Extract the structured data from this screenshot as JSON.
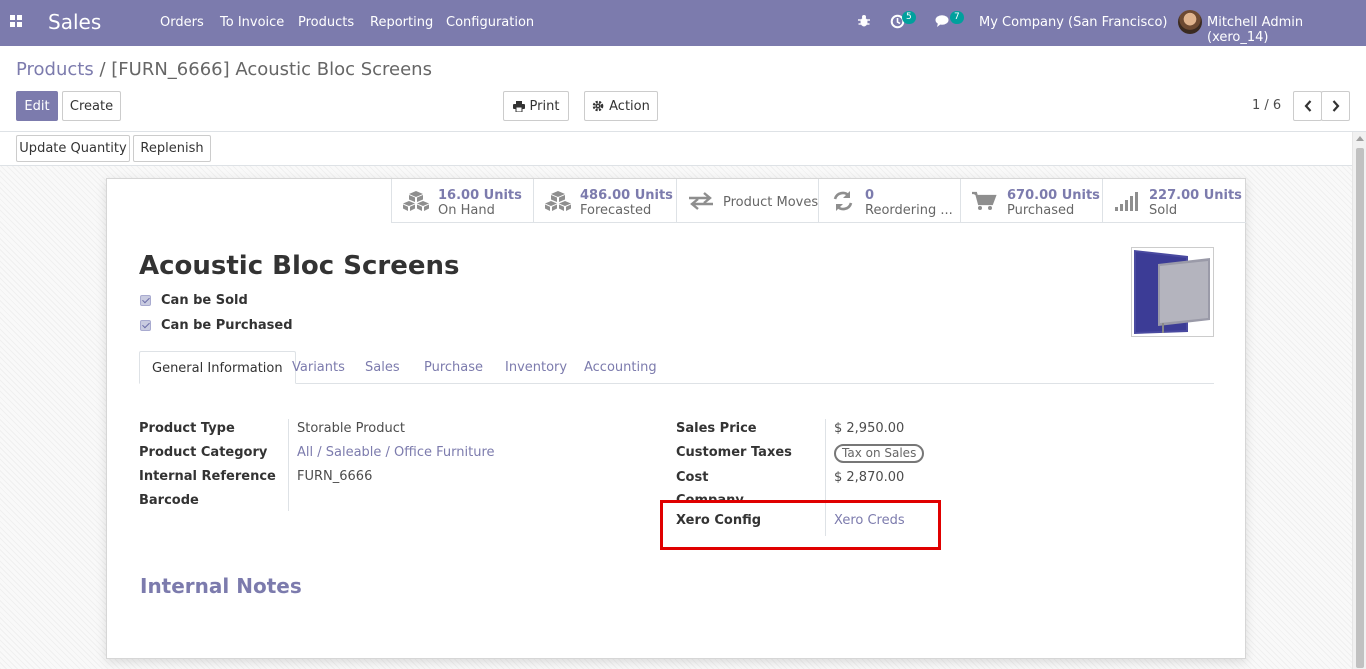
{
  "navbar": {
    "app_name": "Sales",
    "menu": [
      "Orders",
      "To Invoice",
      "Products",
      "Reporting",
      "Configuration"
    ],
    "activity_count": "5",
    "messages_count": "7",
    "company": "My Company (San Francisco)",
    "user": "Mitchell Admin (xero_14)",
    "color": "#7c7bad"
  },
  "breadcrumb": {
    "parent": "Products",
    "separator": "/",
    "current": "[FURN_6666] Acoustic Bloc Screens"
  },
  "buttons": {
    "edit": "Edit",
    "create": "Create",
    "print": "Print",
    "action": "Action",
    "update_quantity": "Update Quantity",
    "replenish": "Replenish"
  },
  "pager": {
    "value": "1 / 6"
  },
  "smart_buttons": [
    {
      "value": "16.00 Units",
      "label": "On Hand",
      "icon": "cubes-icon"
    },
    {
      "value": "486.00 Units",
      "label": "Forecasted",
      "icon": "cubes-icon"
    },
    {
      "value": "",
      "label": "Product Moves",
      "icon": "exchange-icon"
    },
    {
      "value": "0",
      "label": "Reordering ...",
      "icon": "refresh-icon"
    },
    {
      "value": "670.00 Units",
      "label": "Purchased",
      "icon": "shopping-cart-icon"
    },
    {
      "value": "227.00 Units",
      "label": "Sold",
      "icon": "signal-icon"
    }
  ],
  "product": {
    "name": "Acoustic Bloc Screens",
    "can_be_sold": "Can be Sold",
    "can_be_purchased": "Can be Purchased"
  },
  "tabs": [
    "General Information",
    "Variants",
    "Sales",
    "Purchase",
    "Inventory",
    "Accounting"
  ],
  "left_fields": {
    "product_type_label": "Product Type",
    "product_type": "Storable Product",
    "category_label": "Product Category",
    "category": "All / Saleable / Office Furniture",
    "internal_ref_label": "Internal Reference",
    "internal_ref": "FURN_6666",
    "barcode_label": "Barcode"
  },
  "right_fields": {
    "sales_price_label": "Sales Price",
    "sales_price": "$ 2,950.00",
    "customer_taxes_label": "Customer Taxes",
    "customer_taxes": "Tax on Sales",
    "cost_label": "Cost",
    "cost": "$ 2,870.00",
    "company_label": "Company",
    "xero_config_label": "Xero Config",
    "xero_config": "Xero Creds"
  },
  "internal_notes": "Internal Notes",
  "highlight_color": "#e00000"
}
